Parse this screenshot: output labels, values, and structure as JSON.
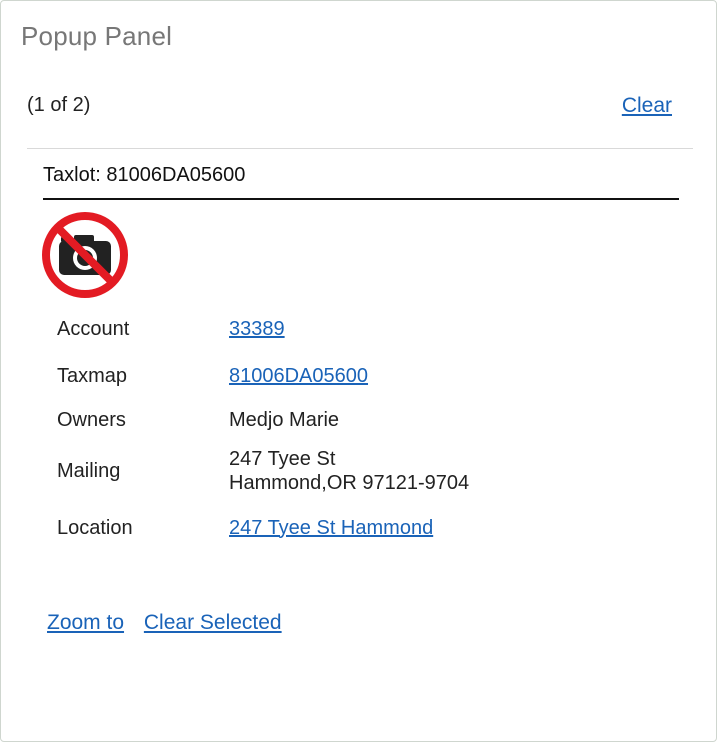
{
  "panel": {
    "title": "Popup Panel",
    "pager": "(1 of 2)",
    "clear_label": "Clear"
  },
  "feature": {
    "title": "Taxlot: 81006DA05600",
    "image_icon": "no-photo-icon",
    "attributes": [
      {
        "label": "Account",
        "value": "33389"
      },
      {
        "label": "Taxmap",
        "value": "81006DA05600"
      },
      {
        "label": "Owners",
        "value": "Medjo Marie"
      },
      {
        "label": "Mailing",
        "value_line1": "247 Tyee St",
        "value_line2": "Hammond,OR 97121-9704"
      },
      {
        "label": "Location",
        "value": "247 Tyee St Hammond"
      }
    ]
  },
  "actions": {
    "zoom_to": "Zoom to",
    "clear_selected": "Clear Selected"
  },
  "colors": {
    "link": "#1a63b8",
    "no_photo_red": "#e31b23"
  }
}
